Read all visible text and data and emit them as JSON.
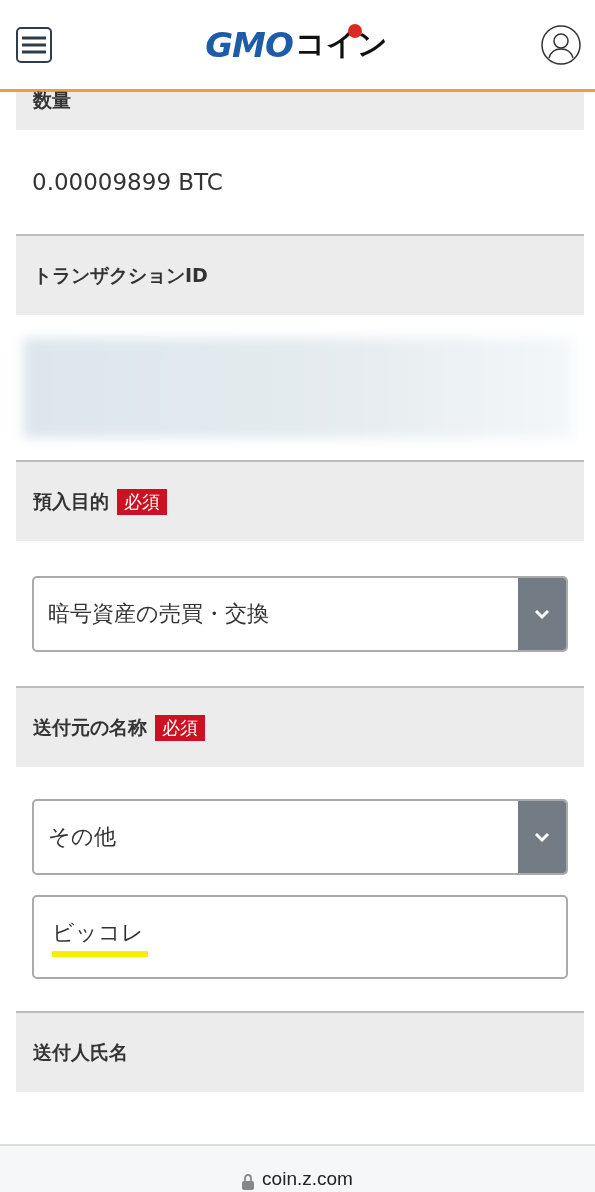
{
  "header": {
    "logo": {
      "primary": "GMO",
      "secondary": "コイン"
    }
  },
  "sections": [
    {
      "kind": "label",
      "text": "数量"
    },
    {
      "kind": "value",
      "text": "0.00009899 BTC"
    },
    {
      "kind": "label",
      "text": "トランザクションID"
    },
    {
      "kind": "redacted"
    },
    {
      "kind": "label",
      "text": "預入目的",
      "badge": "必須"
    },
    {
      "kind": "select",
      "value": "暗号資産の売買・交換"
    },
    {
      "kind": "label",
      "text": "送付元の名称",
      "badge": "必須"
    },
    {
      "kind": "select",
      "value": "その他"
    },
    {
      "kind": "input",
      "value": "ビッコレ",
      "underlined": true
    },
    {
      "kind": "label",
      "text": "送付人氏名"
    }
  ],
  "address_bar": {
    "url": "coin.z.com"
  }
}
